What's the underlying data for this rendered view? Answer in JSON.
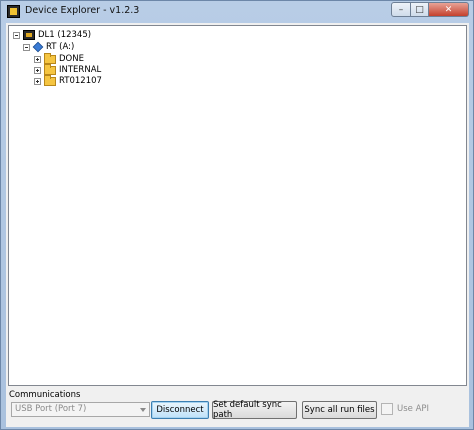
{
  "window": {
    "title": "Device Explorer - v1.2.3"
  },
  "tree": {
    "device": "DL1 (12345)",
    "drive": "RT (A:)",
    "folders": [
      "DONE",
      "INTERNAL",
      "RT012107"
    ]
  },
  "communications": {
    "group_label": "Communications",
    "port_value": "USB Port (Port 7)"
  },
  "buttons": {
    "disconnect": "Disconnect",
    "set_default_sync": "Set default sync path",
    "sync_all": "Sync all run files"
  },
  "options": {
    "use_api_label": "Use API",
    "use_api_checked": false
  },
  "colors": {
    "folder": "#f5c542",
    "drive": "#3a7bd5",
    "titlebar": "#b8cde6"
  },
  "icons": {
    "app": "app-icon",
    "device": "device-icon",
    "drive": "drive-icon",
    "folder": "folder-icon",
    "expand": "expand-icon",
    "collapse": "collapse-icon"
  }
}
